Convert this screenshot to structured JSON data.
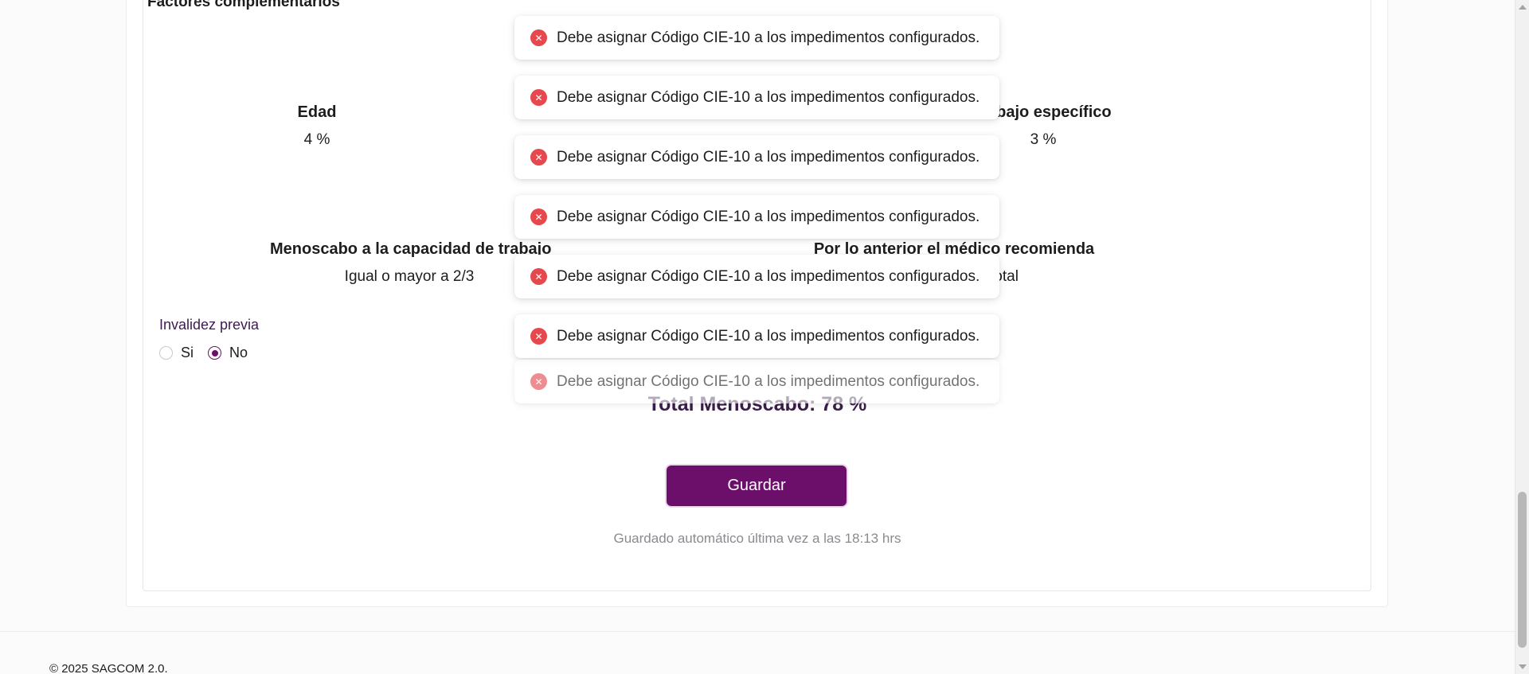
{
  "section": {
    "title": "Factores complementarios"
  },
  "factors": {
    "edad": {
      "label": "Edad",
      "value": "4 %"
    },
    "trabajo": {
      "label": "abajo específico",
      "value": "3 %"
    },
    "menoscabo": {
      "label": "Menoscabo a la capacidad de trabajo",
      "value": "Igual o mayor a 2/3"
    },
    "medico": {
      "label": "Por lo anterior el médico recomienda",
      "value": "total"
    }
  },
  "invalidez_previa": {
    "label": "Invalidez previa",
    "options": [
      "Si",
      "No"
    ],
    "selected": "No"
  },
  "total": {
    "text": "Total Menoscabo: 78 %"
  },
  "actions": {
    "save_label": "Guardar"
  },
  "autosave": {
    "text": "Guardado automático última vez a las 18:13 hrs"
  },
  "footer": {
    "copyright": "© 2025 SAGCOM 2.0."
  },
  "toasts": [
    "Debe asignar Código CIE-10 a los impedimentos configurados.",
    "Debe asignar Código CIE-10 a los impedimentos configurados.",
    "Debe asignar Código CIE-10 a los impedimentos configurados.",
    "Debe asignar Código CIE-10 a los impedimentos configurados.",
    "Debe asignar Código CIE-10 a los impedimentos configurados.",
    "Debe asignar Código CIE-10 a los impedimentos configurados.",
    "Debe asignar Código CIE-10 a los impedimentos configurados."
  ],
  "colors": {
    "primary": "#6b0f6b",
    "error": "#e5484d"
  },
  "icons": {
    "toast": "error-x-icon"
  }
}
